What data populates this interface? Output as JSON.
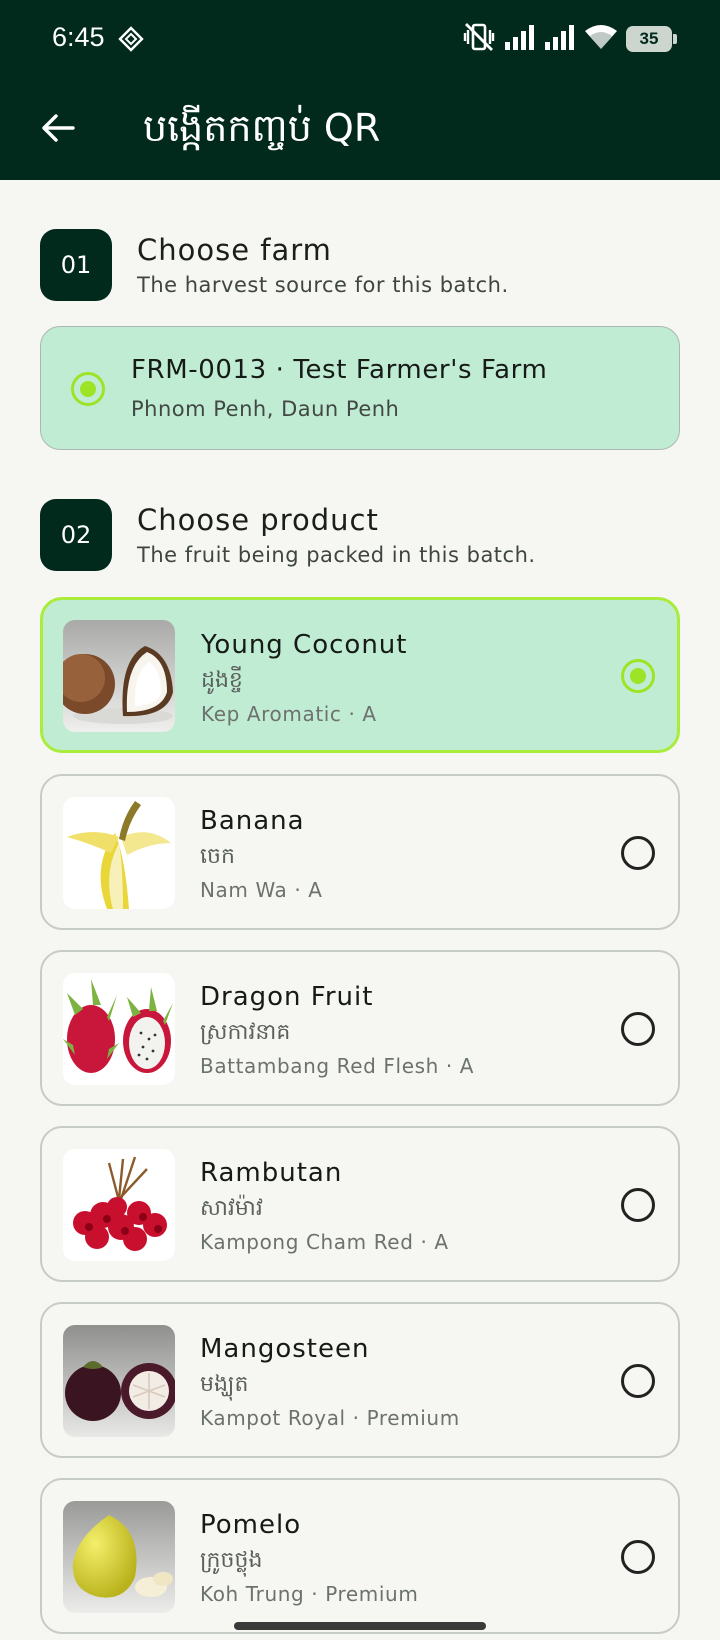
{
  "status": {
    "time": "6:45",
    "battery": "35"
  },
  "appbar": {
    "title": "បង្កើតកញ្ចប់ QR"
  },
  "step1": {
    "number": "01",
    "title": "Choose farm",
    "subtitle": "The harvest source for this batch."
  },
  "farm": {
    "title": "FRM-0013 · Test Farmer's Farm",
    "location": "Phnom Penh, Daun Penh",
    "selected": true
  },
  "step2": {
    "number": "02",
    "title": "Choose product",
    "subtitle": "The fruit being packed in this batch."
  },
  "products": [
    {
      "name": "Young Coconut",
      "khmer": "ដូងខ្ចី",
      "meta": "Kep Aromatic · A",
      "selected": true
    },
    {
      "name": "Banana",
      "khmer": "ចេក",
      "meta": "Nam Wa · A",
      "selected": false
    },
    {
      "name": "Dragon Fruit",
      "khmer": "ស្រកាវនាគ",
      "meta": "Battambang Red Flesh · A",
      "selected": false
    },
    {
      "name": "Rambutan",
      "khmer": "សាវម៉ាវ",
      "meta": "Kampong Cham Red · A",
      "selected": false
    },
    {
      "name": "Mangosteen",
      "khmer": "មង្ឃុត",
      "meta": "Kampot Royal · Premium",
      "selected": false
    },
    {
      "name": "Pomelo",
      "khmer": "ក្រូចថ្លុង",
      "meta": "Koh Trung · Premium",
      "selected": false
    }
  ],
  "colors": {
    "primary": "#01291c",
    "selected_bg": "#c1ecd4",
    "accent": "#a9ec3c",
    "background": "#f6f7f2"
  }
}
